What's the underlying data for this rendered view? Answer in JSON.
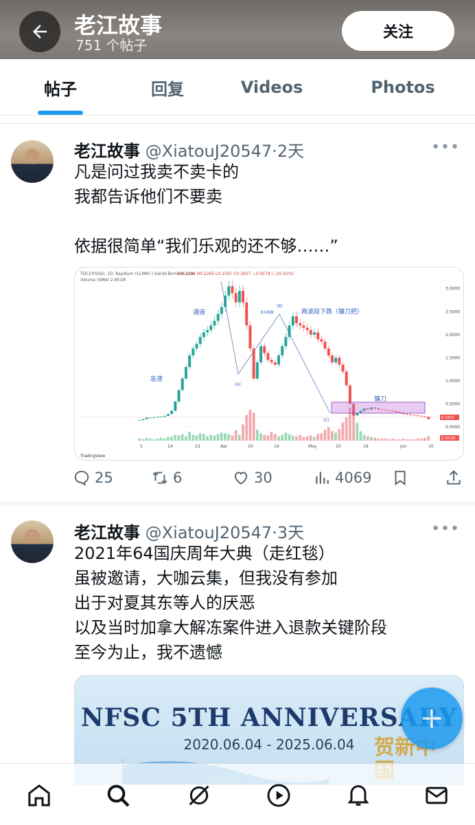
{
  "header": {
    "title": "老江故事",
    "subtitle": "751 个帖子",
    "follow_label": "关注"
  },
  "tabs": [
    {
      "label": "帖子",
      "active": true
    },
    {
      "label": "回复",
      "active": false
    },
    {
      "label": "Videos",
      "active": false
    },
    {
      "label": "Photos",
      "active": false
    }
  ],
  "posts": [
    {
      "name": "老江故事",
      "handle": "@XiatouJ20547",
      "time": "·2天",
      "lines": [
        "凡是问过我卖不卖卡的",
        "我都告诉他们不要卖",
        "",
        "依据很简单“我们乐观的还不够……”"
      ],
      "stats": {
        "replies": "25",
        "reposts": "6",
        "likes": "30",
        "views": "4069"
      }
    },
    {
      "name": "老江故事",
      "handle": "@XiatouJ20547",
      "time": "·3天",
      "lines": [
        "2021年64国庆周年大典（走红毯）",
        "虽被邀请，大咖云集，但我没有参加",
        "出于对夏其东等人的厌恶",
        "以及当时加拿大解冻案件进入退款关键阶段",
        "至今为止，我不遗憾"
      ],
      "banner": {
        "title": "NFSC 5TH ANNIVERSARY",
        "dates": "2020.06.04 - 2025.06.04",
        "gold_text": "贺新中国"
      }
    }
  ],
  "chart_data": {
    "type": "candlestick",
    "header": "TDCCP/USD, 1D, Raydium (CLMM) | GeckoTerminal.com",
    "ohlc_text": "O0.2236 H0.2265 L0.1597 C0.1657 −0.0579 (−25.91%)",
    "volume_label": "Volume (SMA) 2.951M",
    "x_ticks": [
      "5",
      "14",
      "23",
      "Apr",
      "10",
      "19",
      "May",
      "10",
      "19",
      "Jun",
      "10"
    ],
    "y_ticks": [
      "3.0000",
      "2.5000",
      "2.0000",
      "1.5000",
      "1.0000",
      "0.5000",
      "0.0000"
    ],
    "ylim": [
      0,
      3.1
    ],
    "current_price": "0.1657",
    "current_volume": "2.951M",
    "annotations": [
      "急速",
      "通道",
      "(A)",
      "(B)",
      "多头陷阱",
      "两波段下跌（镰刀把）",
      "镰刀",
      "(C)"
    ],
    "closes": [
      0.15,
      0.17,
      0.2,
      0.2,
      0.21,
      0.22,
      0.22,
      0.24,
      0.28,
      0.35,
      0.55,
      0.8,
      1.05,
      1.3,
      1.55,
      1.7,
      1.8,
      1.95,
      2.05,
      2.1,
      2.2,
      2.3,
      2.45,
      2.6,
      2.85,
      3.05,
      2.9,
      2.7,
      2.95,
      2.7,
      2.2,
      1.7,
      1.05,
      1.4,
      1.75,
      1.6,
      1.45,
      1.4,
      1.35,
      1.55,
      1.75,
      1.95,
      2.2,
      2.4,
      2.25,
      2.2,
      2.15,
      2.1,
      2.0,
      2.05,
      1.9,
      1.85,
      1.7,
      1.55,
      1.4,
      1.5,
      1.35,
      1.2,
      0.9,
      0.5,
      0.25,
      0.3,
      0.35,
      0.4,
      0.38,
      0.42,
      0.4,
      0.38,
      0.37,
      0.36,
      0.35,
      0.34,
      0.32,
      0.3,
      0.28,
      0.27,
      0.26,
      0.25,
      0.24,
      0.23,
      0.22,
      0.17
    ],
    "volumes": [
      0.3,
      0.2,
      0.4,
      0.3,
      0.2,
      0.3,
      0.4,
      0.3,
      0.5,
      0.6,
      0.8,
      0.7,
      0.9,
      0.6,
      1.2,
      0.8,
      0.7,
      1.0,
      0.9,
      0.6,
      0.8,
      0.7,
      0.9,
      1.1,
      1.0,
      0.9,
      0.7,
      1.4,
      0.8,
      2.2,
      3.5,
      4.2,
      3.8,
      1.5,
      1.0,
      0.8,
      0.7,
      1.2,
      0.9,
      0.6,
      0.8,
      1.1,
      0.9,
      0.7,
      0.6,
      0.8,
      0.5,
      0.6,
      0.7,
      0.5,
      0.9,
      1.0,
      1.5,
      1.8,
      1.3,
      1.1,
      1.6,
      2.5,
      3.2,
      4.5,
      3.8,
      2.4,
      1.3,
      0.8,
      0.6,
      0.5,
      0.4,
      0.3,
      0.3,
      0.3,
      0.2,
      0.3,
      0.2,
      0.2,
      0.3,
      0.2,
      0.2,
      0.2,
      0.3,
      0.3,
      0.4,
      0.6
    ]
  }
}
